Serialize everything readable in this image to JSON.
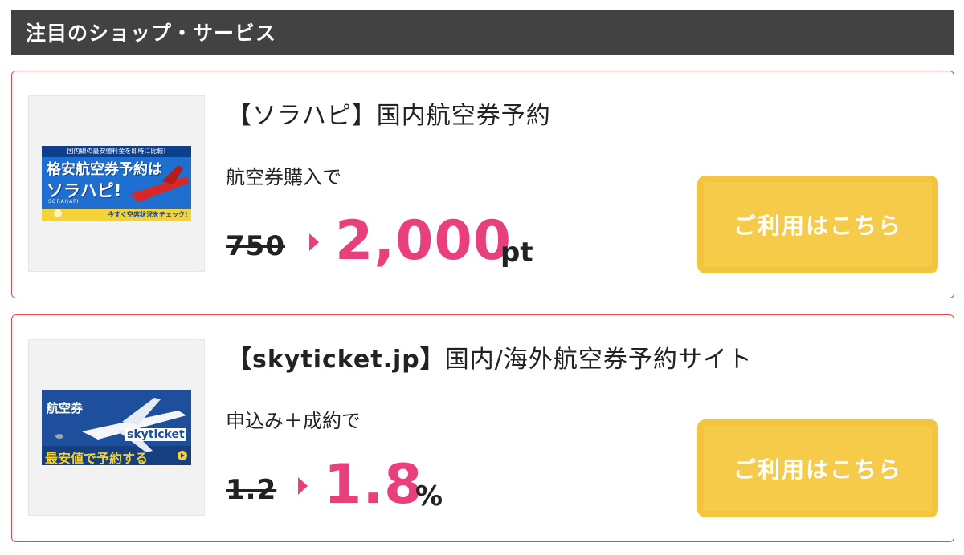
{
  "section": {
    "title": "注目のショップ・サービス"
  },
  "offers": [
    {
      "title_prefix": "【ソラハピ】",
      "title_rest": "国内航空券予約",
      "condition": "航空券購入で",
      "old_rate": "750",
      "new_rate": "2,000",
      "unit": "pt",
      "cta": "ご利用はこちら",
      "banner": {
        "top_line": "国内線の最安値料金を即時に比較!",
        "headline_1": "格安航空券予約は",
        "headline_2": "ソラハピ!",
        "logo": "SORAHAPI",
        "footer": "今すぐ空席状況をチェック!"
      }
    },
    {
      "title_prefix": "【skyticket.jp】",
      "title_rest": "国内/海外航空券予約サイト",
      "condition": "申込み＋成約で",
      "old_rate": "1.2",
      "new_rate": "1.8",
      "unit": "%",
      "cta": "ご利用はこちら",
      "banner": {
        "label": "航空券",
        "logo": "skyticket",
        "footer": "最安値で予約する"
      }
    }
  ],
  "colors": {
    "header_bg": "#424242",
    "card_border": "#e14a4a",
    "accent_pink": "#e8407c",
    "cta_yellow": "#f6cb49"
  }
}
